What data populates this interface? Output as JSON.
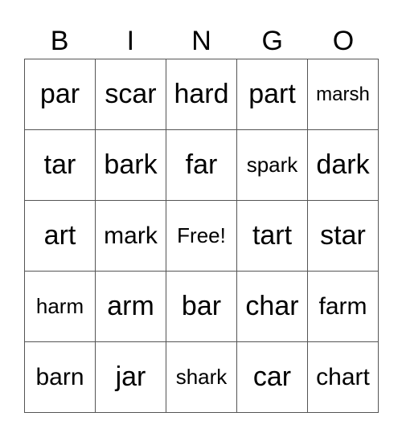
{
  "header": [
    "B",
    "I",
    "N",
    "G",
    "O"
  ],
  "cells": [
    [
      "par",
      "scar",
      "hard",
      "part",
      "marsh"
    ],
    [
      "tar",
      "bark",
      "far",
      "spark",
      "dark"
    ],
    [
      "art",
      "mark",
      "Free!",
      "tart",
      "star"
    ],
    [
      "harm",
      "arm",
      "bar",
      "char",
      "farm"
    ],
    [
      "barn",
      "jar",
      "shark",
      "car",
      "chart"
    ]
  ]
}
